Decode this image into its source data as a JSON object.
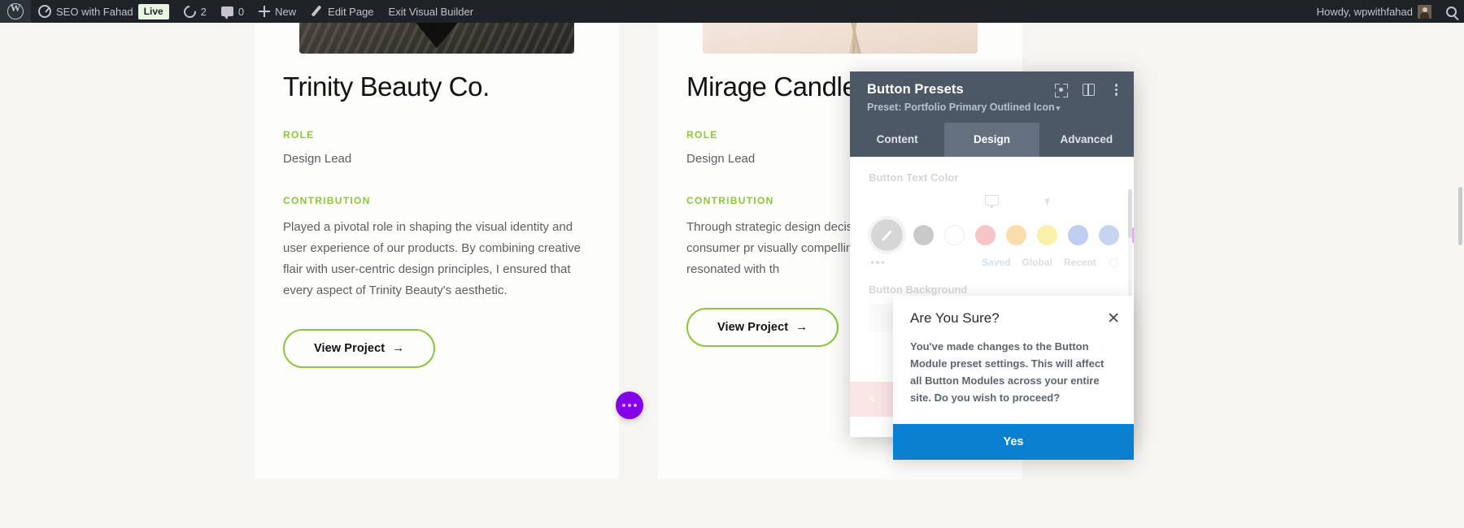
{
  "adminbar": {
    "wp_logo": "wordpress-logo",
    "site_name": "SEO with Fahad",
    "live_badge": "Live",
    "revisions_count": "2",
    "comments_count": "0",
    "new_label": "New",
    "edit_page_label": "Edit Page",
    "exit_builder_label": "Exit Visual Builder",
    "howdy": "Howdy, wpwithfahad"
  },
  "cards": [
    {
      "title": "Trinity Beauty Co.",
      "role_label": "ROLE",
      "role_value": "Design Lead",
      "contribution_label": "CONTRIBUTION",
      "contribution_value": "Played a pivotal role in shaping the visual identity and user experience of our products. By combining creative flair with user-centric design principles, I ensured that every aspect of Trinity Beauty's aesthetic.",
      "button_label": "View Project",
      "button_arrow": "→"
    },
    {
      "title": "Mirage Candle",
      "role_label": "ROLE",
      "role_value": "Design Lead",
      "contribution_label": "CONTRIBUTION",
      "contribution_value": "Through strategic design decis understanding of consumer pr visually compelling packaging, designs that resonated with th",
      "button_label": "View Project",
      "button_arrow": "→"
    }
  ],
  "panel": {
    "title": "Button Presets",
    "preset_line": "Preset: Portfolio Primary Outlined Icon",
    "preset_caret": "▾",
    "tabs": [
      {
        "label": "Content",
        "active": false
      },
      {
        "label": "Design",
        "active": true
      },
      {
        "label": "Advanced",
        "active": false
      }
    ],
    "field_text_color_label": "Button Text Color",
    "field_background_label": "Button Background",
    "palette_links": {
      "saved": "Saved",
      "global": "Global",
      "recent": "Recent"
    },
    "swatch_colors": [
      "#c9c9c9",
      "#fefefe",
      "#f6c6c6",
      "#f9ddac",
      "#fbf0a8",
      "#bfcdf2",
      "#c5d5f0",
      "#ddaaf0"
    ],
    "delete_icon": "×"
  },
  "confirm": {
    "title": "Are You Sure?",
    "close_icon": "✕",
    "body": "You've made changes to the Button Module preset settings. This will affect all Button Modules across your entire site. Do you wish to proceed?",
    "yes_label": "Yes"
  },
  "colors": {
    "accent_green": "#8cc63f",
    "panel_header": "#4c5866",
    "primary_blue": "#0b80d0",
    "fab_purple": "#8300e9"
  }
}
